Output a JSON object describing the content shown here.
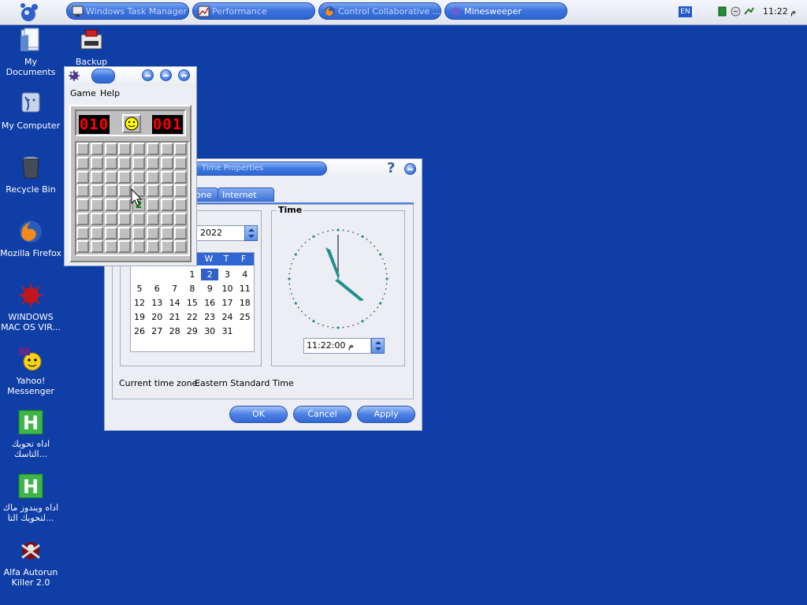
{
  "taskbar": {
    "tasks": [
      {
        "label": "Windows Task Manager",
        "icon": "task-manager-icon",
        "active": false
      },
      {
        "label": "Performance",
        "icon": "performance-icon",
        "active": false
      },
      {
        "label": "Control Collaborative ...",
        "icon": "firefox-icon",
        "active": false
      },
      {
        "label": "Minesweeper",
        "icon": "minesweeper-icon",
        "active": true
      }
    ],
    "language": "EN",
    "clock": "11:22 م"
  },
  "desktop": {
    "icons": [
      {
        "label": "My Documents",
        "icon": "folder-icon"
      },
      {
        "label": "Backup",
        "icon": "backup-icon"
      },
      {
        "label": "My Computer",
        "icon": "computer-icon"
      },
      {
        "label": "Recycle Bin",
        "icon": "recycle-bin-icon"
      },
      {
        "label": "Mozilla Firefox",
        "icon": "firefox-icon"
      },
      {
        "label": "WINDOWS MAC OS VIR...",
        "icon": "virus-icon"
      },
      {
        "label": "Yahoo! Messenger",
        "icon": "yahoo-icon"
      },
      {
        "label": "اداه تحويك التاسك...",
        "icon": "h-app-icon"
      },
      {
        "label": "اداه ويندوز ماك لتحويك التا...",
        "icon": "h-app-icon"
      },
      {
        "label": "Alfa Autorun Killer 2.0",
        "icon": "autorun-killer-icon"
      }
    ]
  },
  "datetime_dialog": {
    "title": "Date and Time Properties",
    "title_visible": "Time Properties",
    "tabs": [
      "one",
      "Internet Time"
    ],
    "year": "2022",
    "calendar": {
      "headers": [
        "W",
        "T",
        "F"
      ],
      "weeks": [
        [
          "",
          "",
          "",
          "1",
          "2",
          "3",
          "4"
        ],
        [
          "5",
          "6",
          "7",
          "8",
          "9",
          "10",
          "11"
        ],
        [
          "12",
          "13",
          "14",
          "15",
          "16",
          "17",
          "18"
        ],
        [
          "19",
          "20",
          "21",
          "22",
          "23",
          "24",
          "25"
        ],
        [
          "26",
          "27",
          "28",
          "29",
          "30",
          "31",
          ""
        ]
      ],
      "selected": "2"
    },
    "time_group_label": "Time",
    "time_value": "11:22:00 م",
    "timezone_label": "Current time zone:",
    "timezone_value": "Eastern Standard Time",
    "buttons": {
      "ok": "OK",
      "cancel": "Cancel",
      "apply": "Apply"
    },
    "accent_color": "#1f8f8f"
  },
  "minesweeper": {
    "menu": [
      "Game",
      "Help"
    ],
    "mines_left": "010",
    "timer": "001",
    "rows": 8,
    "cols": 8,
    "revealed_cell": "2"
  }
}
